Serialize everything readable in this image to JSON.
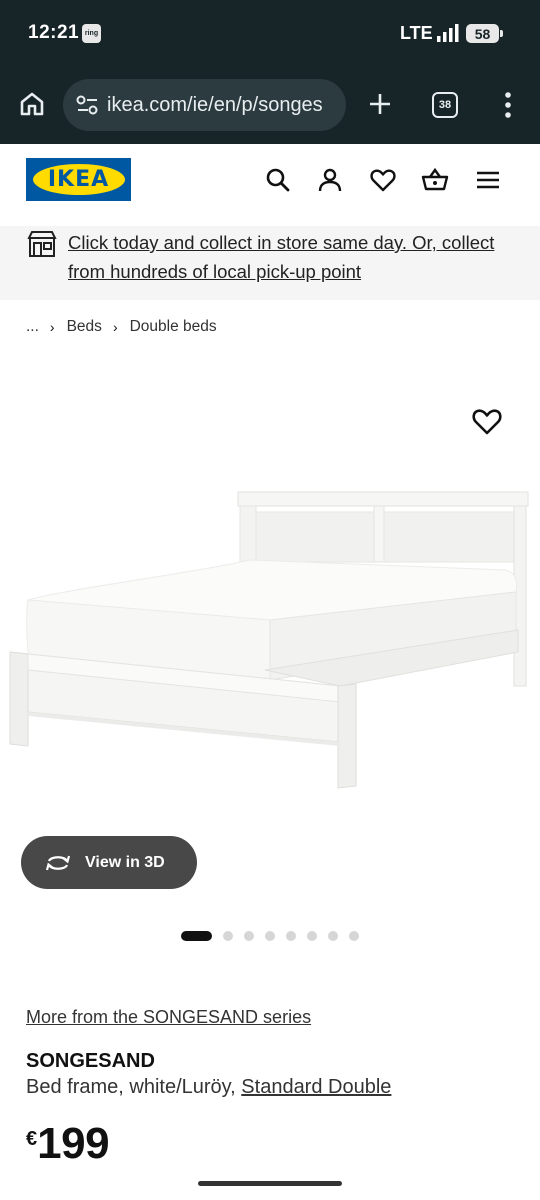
{
  "status_bar": {
    "time": "12:21",
    "notification_badge": "ring",
    "network": "LTE",
    "battery": "58"
  },
  "browser": {
    "url": "ikea.com/ie/en/p/songes",
    "tab_count": "38",
    "icons": [
      "home-icon",
      "site-settings-icon",
      "new-tab-icon",
      "tabs-icon",
      "overflow-menu-icon"
    ]
  },
  "header": {
    "logo_text": "IKEA",
    "icons": [
      "search-icon",
      "account-icon",
      "wishlist-icon",
      "basket-icon",
      "hamburger-menu-icon"
    ]
  },
  "promo": {
    "text": "Click today and collect in store same day. Or, collect from hundreds of local pick-up point",
    "icon": "store-icon"
  },
  "breadcrumb": {
    "items": [
      "...",
      "Beds",
      "Double beds"
    ]
  },
  "gallery": {
    "view_3d_label": "View in 3D",
    "image_count": 8,
    "active_index": 0
  },
  "product": {
    "series_link": "More from the SONGESAND series",
    "name": "SONGESAND",
    "description": "Bed frame, white/Luröy, ",
    "size": "Standard Double",
    "currency": "€",
    "price": "199"
  },
  "colors": {
    "system_bar": "#172428",
    "ikea_blue": "#0058a3",
    "ikea_yellow": "#ffdb00",
    "view_3d_button": "#484848"
  }
}
